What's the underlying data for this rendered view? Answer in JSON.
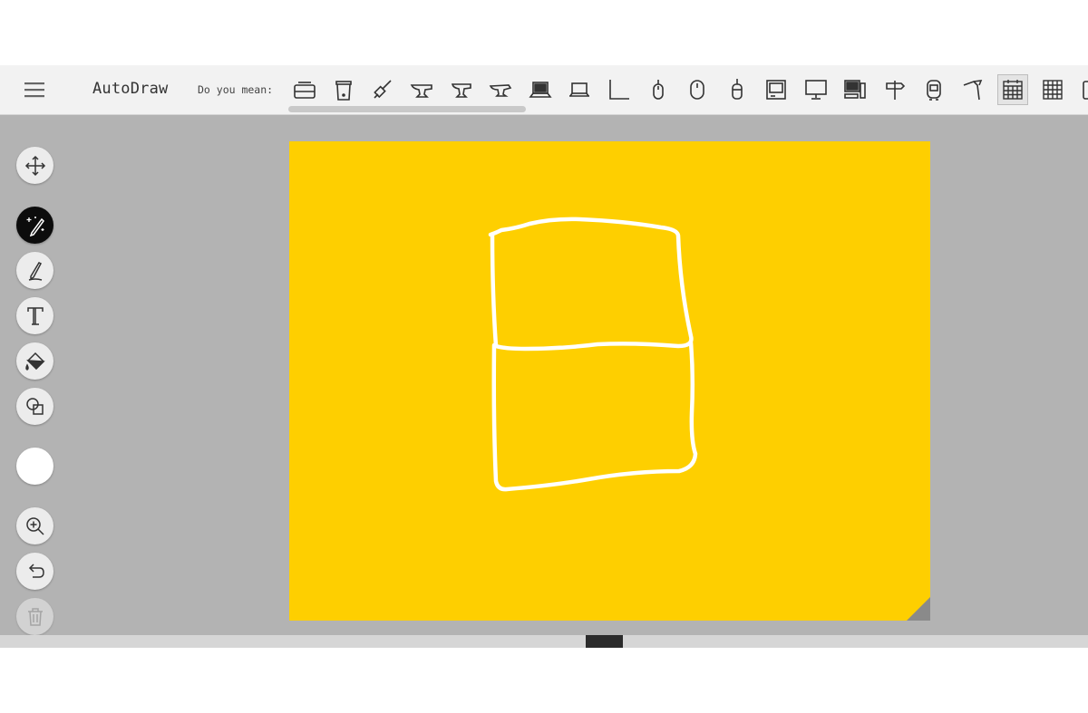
{
  "app": {
    "title": "AutoDraw",
    "menu_icon": "hamburger-menu-icon"
  },
  "suggestions": {
    "label": "Do you mean:",
    "items": [
      {
        "icon": "toaster-icon"
      },
      {
        "icon": "trash-can-icon"
      },
      {
        "icon": "paintbrush-icon"
      },
      {
        "icon": "anvil-icon"
      },
      {
        "icon": "anvil-icon"
      },
      {
        "icon": "anvil-icon"
      },
      {
        "icon": "laptop-icon"
      },
      {
        "icon": "laptop-icon"
      },
      {
        "icon": "corner-angle-icon"
      },
      {
        "icon": "computer-mouse-icon"
      },
      {
        "icon": "computer-mouse-icon"
      },
      {
        "icon": "computer-mouse-icon"
      },
      {
        "icon": "retro-computer-icon"
      },
      {
        "icon": "desktop-monitor-icon"
      },
      {
        "icon": "desktop-computer-icon"
      },
      {
        "icon": "signpost-icon"
      },
      {
        "icon": "robot-icon"
      },
      {
        "icon": "hand-tool-icon"
      },
      {
        "icon": "calendar-icon",
        "selected": true
      },
      {
        "icon": "grid-icon"
      },
      {
        "icon": "partial-icon"
      }
    ]
  },
  "toolbar": {
    "tools": [
      {
        "name": "select",
        "icon": "move-arrows-icon"
      },
      {
        "name": "autodraw",
        "icon": "autodraw-sparkle-pencil-icon",
        "active": true
      },
      {
        "name": "draw",
        "icon": "pencil-icon"
      },
      {
        "name": "type",
        "icon": "text-t-icon"
      },
      {
        "name": "fill",
        "icon": "paint-bucket-icon"
      },
      {
        "name": "shape",
        "icon": "shapes-icon"
      },
      {
        "name": "color",
        "icon": "color-swatch-icon"
      },
      {
        "name": "zoom",
        "icon": "zoom-in-icon"
      },
      {
        "name": "undo",
        "icon": "undo-icon"
      },
      {
        "name": "delete",
        "icon": "trash-icon",
        "disabled": true
      }
    ]
  },
  "colors": {
    "canvas_background": "#fecf00",
    "stroke": "#ffffff",
    "selected_color": "#ffffff",
    "workspace": "#b3b3b3",
    "topbar": "#f2f2f2",
    "active_tool": "#0c0c0c"
  }
}
